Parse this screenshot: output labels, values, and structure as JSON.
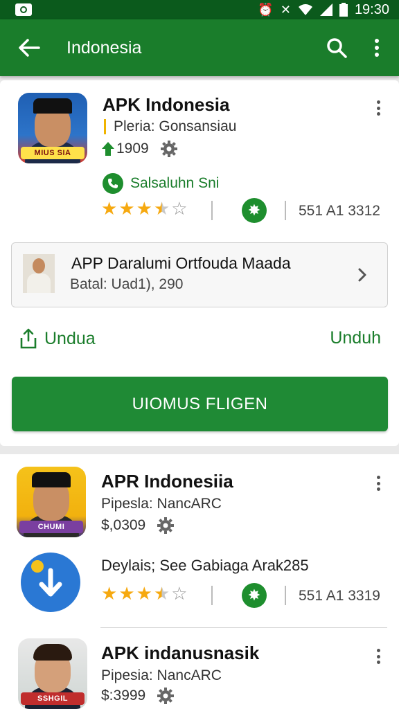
{
  "status_bar": {
    "time": "19:30"
  },
  "app_bar": {
    "title": "Indonesia"
  },
  "card1": {
    "title": "APK Indonesia",
    "subtitle": "Pleria: Gonsansiau",
    "downloads": "1909",
    "developer": "Salsaluhn Sni",
    "rating": 3.5,
    "count": "551 A1 3312",
    "thumb_banner": "MIUS SIA",
    "feature": {
      "title": "APP Daralumi Ortfouda Maada",
      "subtitle": "Batal: Uad1), 290"
    },
    "share_label": "Undua",
    "download_label": "Unduh",
    "primary_button": "UIOMUS FLIGEN"
  },
  "card2": {
    "item1": {
      "title": "APR Indonesiia",
      "subtitle": "Pipesla: NancARC",
      "price": "$,0309",
      "thumb_banner": "CHUMI"
    },
    "item2": {
      "details": "Deylais; See Gabiaga Arak285",
      "rating": 3.5,
      "count": "551 A1 3319"
    },
    "item3": {
      "title": "APK indanusnasik",
      "subtitle": "Pipesia: NancARC",
      "price": "$:3999",
      "thumb_banner": "SSHGIL"
    }
  },
  "colors": {
    "primary": "#1a7d2b",
    "status_bar": "#0b5a1c",
    "star": "#f6a910"
  },
  "icons": [
    "back-arrow-icon",
    "search-icon",
    "more-vert-icon",
    "gear-icon",
    "phone-icon",
    "share-icon",
    "chevron-right-icon",
    "download-icon"
  ]
}
